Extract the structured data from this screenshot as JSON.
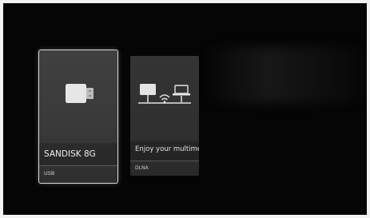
{
  "sources": [
    {
      "title": "SANDISK 8G",
      "subtitle": "USB",
      "icon": "usb-drive-icon",
      "focused": true
    },
    {
      "title": "Enjoy your multimed",
      "subtitle": "DLNA",
      "icon": "dlna-network-icon",
      "focused": false
    }
  ]
}
